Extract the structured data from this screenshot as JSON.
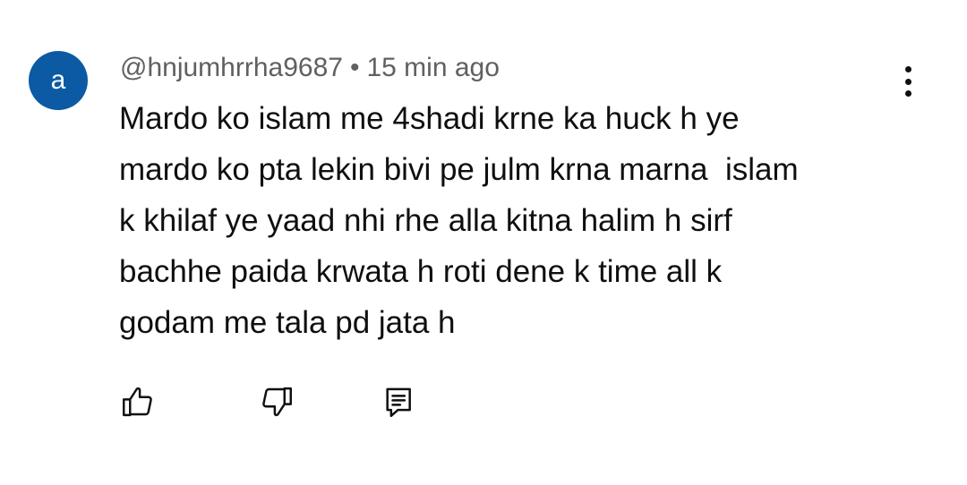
{
  "comment": {
    "avatar_letter": "a",
    "avatar_color": "#0b5aa3",
    "username": "@hnjumhrrha9687",
    "separator": "•",
    "timestamp": "15 min ago",
    "text": "Mardo ko islam me 4shadi krne ka huck h ye\nmardo ko pta lekin bivi pe julm krna marna  islam\nk khilaf ye yaad nhi rhe alla kitna halim h sirf\nbachhe paida krwata h roti dene k time all k\ngodam me tala pd jata h"
  },
  "icons": {
    "menu": "more-vertical-icon",
    "like": "thumbs-up-icon",
    "dislike": "thumbs-down-icon",
    "reply": "reply-comment-icon"
  }
}
